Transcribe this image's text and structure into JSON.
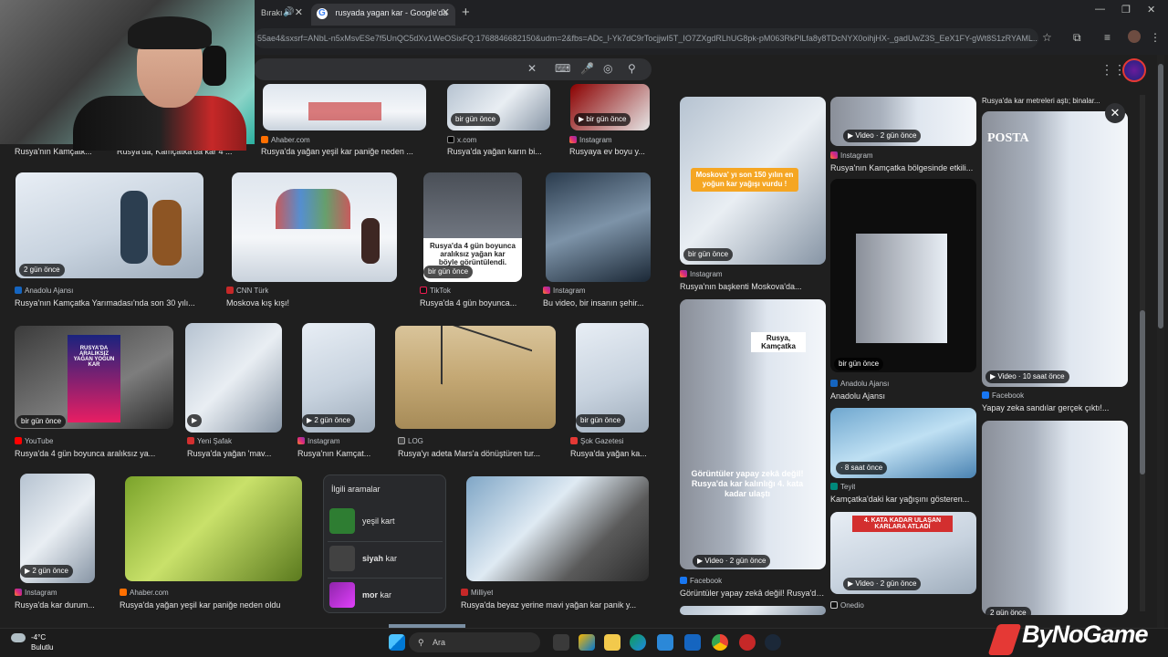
{
  "browser": {
    "tabs": [
      {
        "label": "Bırakı"
      },
      {
        "label": "rusyada yagan kar - Google'da"
      }
    ],
    "new_tab": "+",
    "window_controls": [
      "—",
      "❐",
      "✕"
    ],
    "url": "55ae4&sxsrf=ANbL-n5xMsvESe7f5UnQC5dXv1WeOSixFQ:1768846682150&udm=2&fbs=ADc_l-Yk7dC9rTocjjwI5T_IO7ZXgdRLhUG8pk-pM063RkPlLfa8y8TDcNYX0oihjHX-_gadUwZ3S_EeX1FY-gWt8S1zRYAML..."
  },
  "search": {
    "clear": "✕",
    "icons": [
      "keyboard-icon",
      "mic-icon",
      "lens-icon",
      "search-icon"
    ]
  },
  "results": {
    "row0": [
      {
        "source": "",
        "title": "Rusya'nın Kamçatk..."
      },
      {
        "source": "",
        "title": "Rusya'da, Kamçatka'da kar 4 ..."
      },
      {
        "source": "Ahaber.com",
        "title": "Rusya'da yağan yeşil kar paniğe neden ..."
      },
      {
        "source": "x.com",
        "title": "Rusya'da yağan karın bi...",
        "badge": "bir gün önce"
      },
      {
        "source": "Instagram",
        "title": "Rusyaya ev boyu y...",
        "badge": "▶ bir gün önce"
      }
    ],
    "row1": [
      {
        "source": "Anadolu Ajansı",
        "title": "Rusya'nın Kamçatka Yarımadası'nda son 30 yılı...",
        "badge": "2 gün önce"
      },
      {
        "source": "CNN Türk",
        "title": "Moskova kış kışı!"
      },
      {
        "source": "TikTok",
        "title": "Rusya'da 4 gün boyunca...",
        "badge": "bir gün önce"
      },
      {
        "source": "Instagram",
        "title": "Bu video, bir insanın şehir..."
      }
    ],
    "row1_overlay": [
      "Rusya'da 4 gün boyunca",
      "aralıksız yağan kar",
      "böyle görüntülendi."
    ],
    "row2": [
      {
        "source": "YouTube",
        "title": "Rusya'da 4 gün boyunca aralıksız ya...",
        "badge": "bir gün önce"
      },
      {
        "source": "Yeni Şafak",
        "title": "Rusya'da yağan 'mav...",
        "badge": "▶"
      },
      {
        "source": "Instagram",
        "title": "Rusya'nın Kamçat...",
        "badge": "▶ 2 gün önce"
      },
      {
        "source": "LOG",
        "title": "Rusya'yı adeta Mars'a dönüştüren tur..."
      },
      {
        "source": "Şok Gazetesi",
        "title": "Rusya'da yağan ka...",
        "badge": "bir gün önce"
      }
    ],
    "row2_overlay": [
      "RUSYA'DA ARALIKSIZ",
      "YAĞAN YOĞUN KAR"
    ],
    "row3": [
      {
        "source": "Instagram",
        "title": "Rusya'da kar durum...",
        "badge": "▶ 2 gün önce"
      },
      {
        "source": "Ahaber.com",
        "title": "Rusya'da yağan yeşil kar paniğe neden oldu"
      },
      {
        "source": "Milliyet",
        "title": "Rusya'da beyaz yerine mavi yağan kar panik y..."
      }
    ]
  },
  "related": {
    "title": "İlgili aramalar",
    "items": [
      {
        "bold": "",
        "rest": "yeşil kart"
      },
      {
        "bold": "siyah",
        "rest": " kar"
      },
      {
        "bold": "mor",
        "rest": " kar"
      }
    ]
  },
  "panel": {
    "col1": [
      {
        "badge": "bir gün önce",
        "overlay": "Moskova' yı son 150 yılın en yoğun kar yağışı vurdu !",
        "source": "Instagram",
        "title": "Rusya'nın başkenti Moskova'da..."
      },
      {
        "badge": "▶ Video · 2 gün önce",
        "overlay_top": "Rusya, Kamçatka",
        "overlay": "Görüntüler yapay zekâ değil! Rusya'da kar kalınlığı 4. kata kadar ulaştı",
        "source": "Facebook",
        "title": "Görüntüler yapay zekâ değil! Rusya'da..."
      }
    ],
    "col2": [
      {
        "badge": "▶ Video · 2 gün önce",
        "source": "Instagram",
        "title": "Rusya'nın Kamçatka bölgesinde etkili..."
      },
      {
        "badge": "bir gün önce",
        "source": "Anadolu Ajansı",
        "title": "Anadolu Ajansı"
      },
      {
        "badge": "· 8 saat önce",
        "source": "Teyit",
        "title": "Kamçatka'daki kar yağışını gösteren..."
      },
      {
        "badge": "▶ Video · 2 gün önce",
        "overlay": "4. KATA KADAR ULAŞAN KARLARA ATLADI",
        "source": "Onedio",
        "title": ""
      }
    ],
    "col3": [
      {
        "heading": "Rusya'da kar metreleri aştı; binalar...",
        "overlay": "POSTA",
        "badge": "▶ Video · 10 saat önce",
        "source": "Facebook",
        "title": "Yapay zeka sandılar gerçek çıktı!..."
      },
      {
        "badge": "2 gün önce"
      }
    ],
    "close": "✕"
  },
  "taskbar": {
    "temp": "-4°C",
    "condition": "Bulutlu",
    "search_placeholder": "Ara"
  },
  "overlay_brand": "ByNoGame"
}
